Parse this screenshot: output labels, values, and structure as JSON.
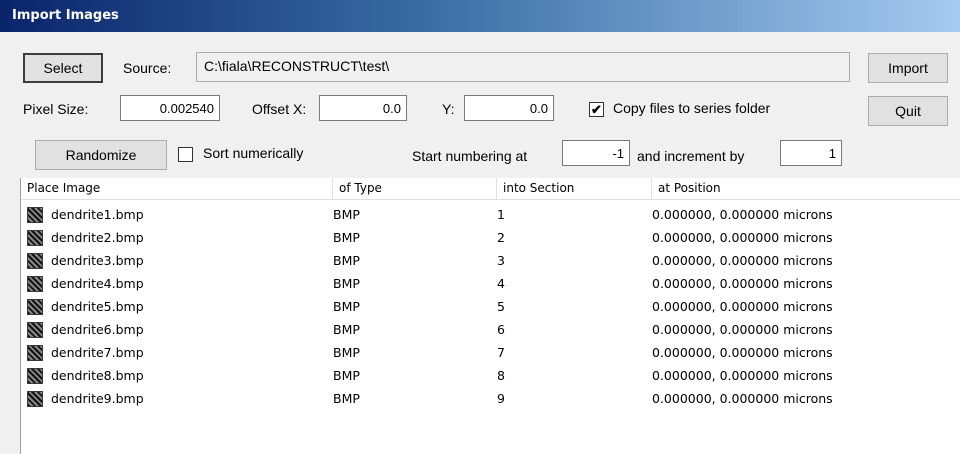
{
  "window": {
    "title": "Import Images"
  },
  "toolbar": {
    "select_label": "Select",
    "source_label": "Source:",
    "source_path": "C:\\fiala\\RECONSTRUCT\\test\\",
    "import_label": "Import",
    "quit_label": "Quit"
  },
  "settings": {
    "pixel_size_label": "Pixel Size:",
    "pixel_size_value": "0.002540",
    "offset_x_label": "Offset X:",
    "offset_x_value": "0.0",
    "offset_y_label": "Y:",
    "offset_y_value": "0.0",
    "copy_files_label": "Copy files to series folder",
    "copy_files_checked": "✔",
    "randomize_label": "Randomize",
    "sort_numerically_label": "Sort numerically",
    "start_numbering_label": "Start numbering at",
    "start_numbering_value": "-1",
    "increment_label": "and increment by",
    "increment_value": "1"
  },
  "list": {
    "columns": [
      "Place Image",
      "of Type",
      "into Section",
      "at Position"
    ],
    "rows": [
      {
        "name": "dendrite1.bmp",
        "type": "BMP",
        "section": "1",
        "position": "0.000000, 0.000000 microns"
      },
      {
        "name": "dendrite2.bmp",
        "type": "BMP",
        "section": "2",
        "position": "0.000000, 0.000000 microns"
      },
      {
        "name": "dendrite3.bmp",
        "type": "BMP",
        "section": "3",
        "position": "0.000000, 0.000000 microns"
      },
      {
        "name": "dendrite4.bmp",
        "type": "BMP",
        "section": "4",
        "position": "0.000000, 0.000000 microns"
      },
      {
        "name": "dendrite5.bmp",
        "type": "BMP",
        "section": "5",
        "position": "0.000000, 0.000000 microns"
      },
      {
        "name": "dendrite6.bmp",
        "type": "BMP",
        "section": "6",
        "position": "0.000000, 0.000000 microns"
      },
      {
        "name": "dendrite7.bmp",
        "type": "BMP",
        "section": "7",
        "position": "0.000000, 0.000000 microns"
      },
      {
        "name": "dendrite8.bmp",
        "type": "BMP",
        "section": "8",
        "position": "0.000000, 0.000000 microns"
      },
      {
        "name": "dendrite9.bmp",
        "type": "BMP",
        "section": "9",
        "position": "0.000000, 0.000000 microns"
      }
    ]
  },
  "icons": {
    "file_icon": "bitmap-file-icon",
    "check_icon": "checkmark-icon"
  },
  "colors": {
    "title_bar_start": "#0a246a",
    "title_bar_end": "#a6caf0",
    "dialog_bg": "#f0f0f0"
  }
}
